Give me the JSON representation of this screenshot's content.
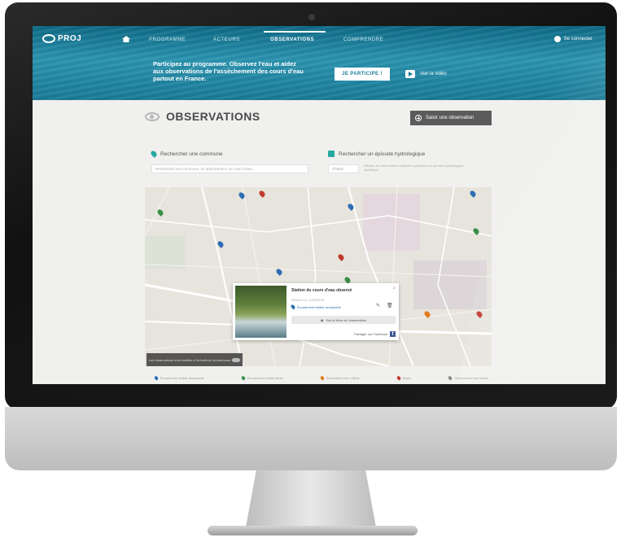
{
  "header": {
    "logo_text": "PROJ",
    "nav": [
      "Programme",
      "Acteurs",
      "Observations",
      "Comprendre"
    ],
    "active_nav": "Observations",
    "login_label": "Se connecter",
    "promo_text": "Participez au programme. Observez l'eau et aidez aux observations de l'assèchement des cours d'eau partout en France.",
    "cta_primary": "JE PARTICIPE !",
    "cta_video": "Voir la vidéo"
  },
  "main": {
    "title": "OBSERVATIONS",
    "add_button": "Saisir une observation",
    "filter_location_label": "Rechercher une commune",
    "search_placeholder": "Rechercher une commune, un département, un cours d'eau",
    "filter_date_label": "Rechercher un épisode hydrologique",
    "date_select": "Choisir",
    "date_hint": "Afficher les observations réalisées pendant une période hydrologique spécifique"
  },
  "map": {
    "caption": "Les observations sont visibles à l'échelle de la commune",
    "popup": {
      "title": "Station du cours d'eau observé",
      "date": "Observé le 12/08/2016",
      "link": "Écoulement visible acceptable",
      "action": "Voir la fiche de l'observation",
      "share": "Partager sur Facebook"
    },
    "markers": [
      {
        "color": "#2e6db4"
      },
      {
        "color": "#c0392b"
      },
      {
        "color": "#2e6db4"
      },
      {
        "color": "#3a8f4a"
      },
      {
        "color": "#2e6db4"
      },
      {
        "color": "#2e6db4"
      },
      {
        "color": "#c0392b"
      },
      {
        "color": "#2e6db4"
      },
      {
        "color": "#3a8f4a"
      },
      {
        "color": "#c0392b"
      },
      {
        "color": "#e07b1a"
      },
      {
        "color": "#3a8f4a"
      }
    ]
  },
  "legend": [
    {
      "label": "Écoulement visible acceptable",
      "color": "#2e6db4"
    },
    {
      "label": "Écoulement visible faible",
      "color": "#3a8f4a"
    },
    {
      "label": "Écoulement non visible",
      "color": "#e07b1a"
    },
    {
      "label": "Assec",
      "color": "#c0392b"
    },
    {
      "label": "Observation impossible",
      "color": "#888888"
    }
  ],
  "colors": {
    "accent": "#1a7b98",
    "teal": "#27a9a0",
    "button_dark": "#5b5b5b"
  }
}
